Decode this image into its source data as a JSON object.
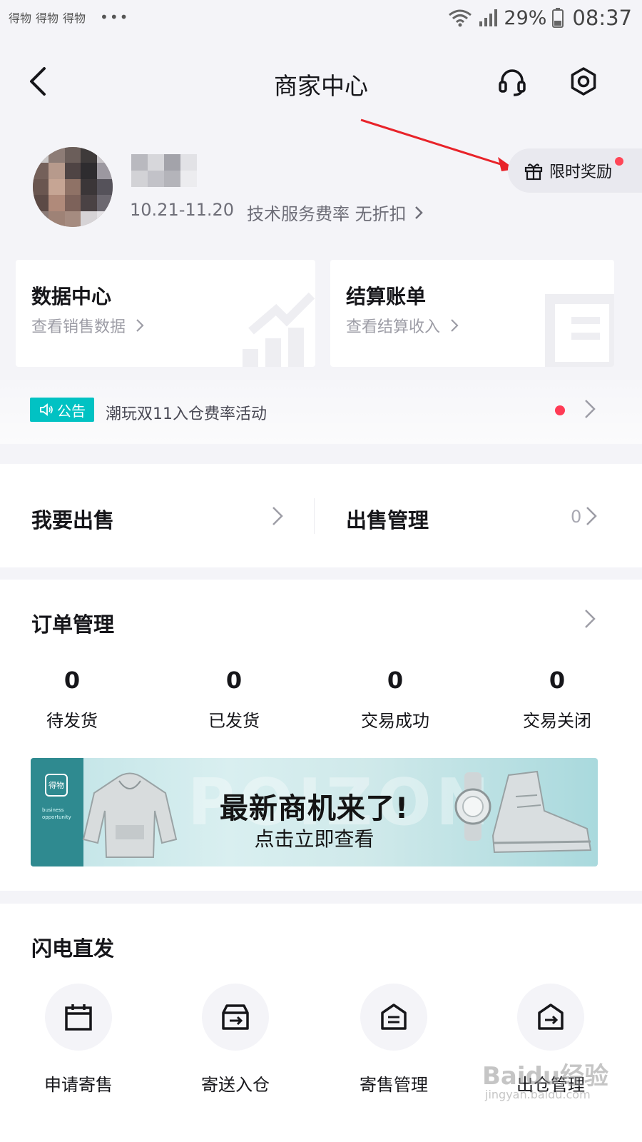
{
  "status_bar": {
    "app_badges": [
      "得物",
      "得物",
      "得物"
    ],
    "more": "•••",
    "battery_pct": "29%",
    "time": "08:37"
  },
  "header": {
    "title": "商家中心"
  },
  "profile": {
    "period": "10.21-11.20",
    "fee_text": "技术服务费率 无折扣",
    "reward_label": "限时奖励"
  },
  "cards": {
    "data_center": {
      "title": "数据中心",
      "subtitle": "查看销售数据"
    },
    "settlement": {
      "title": "结算账单",
      "subtitle": "查看结算收入"
    }
  },
  "announcement": {
    "tag": "公告",
    "text": "潮玩双11入仓费率活动"
  },
  "sell": {
    "sell_label": "我要出售",
    "manage_label": "出售管理",
    "manage_count": "0"
  },
  "orders": {
    "title": "订单管理",
    "stats": [
      {
        "count": "0",
        "label": "待发货"
      },
      {
        "count": "0",
        "label": "已发货"
      },
      {
        "count": "0",
        "label": "交易成功"
      },
      {
        "count": "0",
        "label": "交易关闭"
      }
    ]
  },
  "banner": {
    "logo": "得物",
    "side_text": "business opportunity",
    "watermark": "POIZON",
    "headline": "最新商机来了!",
    "subline": "点击立即查看"
  },
  "flash": {
    "title": "闪电直发",
    "items": [
      {
        "label": "申请寄售",
        "icon": "calendar-icon"
      },
      {
        "label": "寄送入仓",
        "icon": "warehouse-box-icon"
      },
      {
        "label": "寄售管理",
        "icon": "document-house-icon"
      },
      {
        "label": "出仓管理",
        "icon": "warehouse-out-icon"
      }
    ]
  },
  "watermark": {
    "brand": "Baidu经验",
    "url": "jingyan.baidu.com"
  }
}
